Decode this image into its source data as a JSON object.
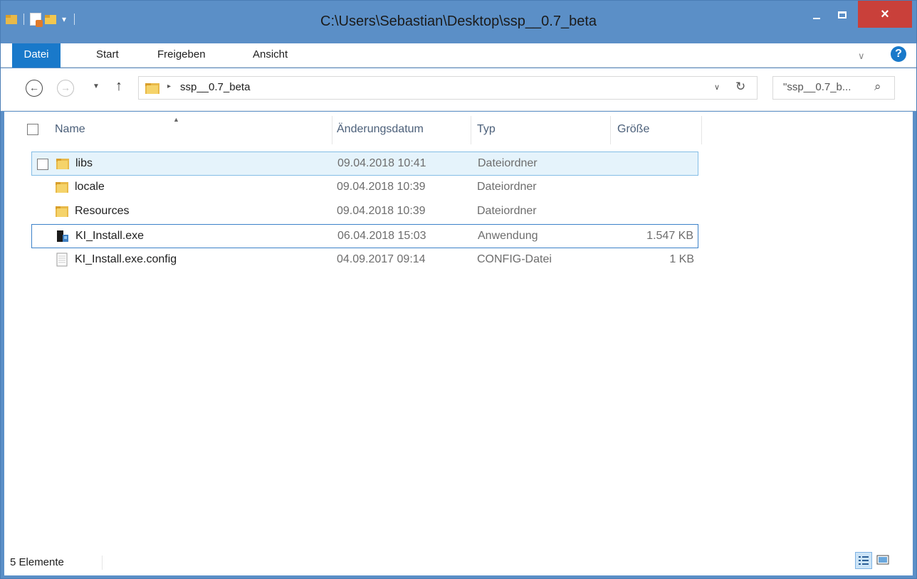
{
  "window": {
    "title": "C:\\Users\\Sebastian\\Desktop\\ssp__0.7_beta",
    "close_glyph": "×"
  },
  "ribbon": {
    "tabs": [
      "Datei",
      "Start",
      "Freigeben",
      "Ansicht"
    ],
    "expand_glyph": "∨",
    "help_glyph": "?"
  },
  "navigation": {
    "back_glyph": "←",
    "forward_glyph": "→",
    "recent_glyph": "▼",
    "up_glyph": "↑",
    "breadcrumb": "ssp__0.7_beta",
    "crumb_arrow": "▸",
    "address_dropdown_glyph": "∨",
    "refresh_glyph": "↻",
    "search_placeholder": "\"ssp__0.7_b...",
    "search_glyph": "⌕"
  },
  "file_list": {
    "columns": [
      "Name",
      "Änderungsdatum",
      "Typ",
      "Größe"
    ],
    "sort_glyph": "▲",
    "items": [
      {
        "name": "libs",
        "date": "09.04.2018 10:41",
        "type": "Dateiordner",
        "size": "",
        "icon": "folder-icon",
        "selected": true
      },
      {
        "name": "locale",
        "date": "09.04.2018 10:39",
        "type": "Dateiordner",
        "size": "",
        "icon": "folder-icon",
        "selected": false
      },
      {
        "name": "Resources",
        "date": "09.04.2018 10:39",
        "type": "Dateiordner",
        "size": "",
        "icon": "folder-icon",
        "selected": false
      },
      {
        "name": "KI_Install.exe",
        "date": "06.04.2018 15:03",
        "type": "Anwendung",
        "size": "1.547 KB",
        "icon": "application-icon",
        "selected": false,
        "focused": true
      },
      {
        "name": "KI_Install.exe.config",
        "date": "04.09.2017 09:14",
        "type": "CONFIG-Datei",
        "size": "1 KB",
        "icon": "config-file-icon",
        "selected": false
      }
    ]
  },
  "status_bar": {
    "item_count": "5 Elemente"
  },
  "colors": {
    "title_bar": "#5b8fc7",
    "file_tab": "#1979ca",
    "close_button": "#c9403a",
    "selection": "#e5f3fb",
    "column_header_text": "#4c607a"
  }
}
